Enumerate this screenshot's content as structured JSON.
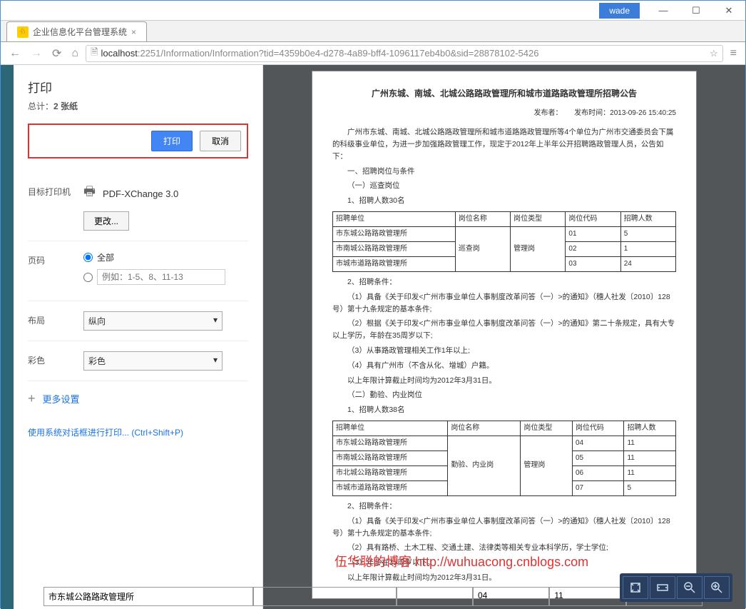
{
  "window": {
    "user": "wade",
    "tab_title": "企业信息化平台管理系统",
    "min_tip": "—",
    "max_tip": "☐",
    "close_tip": "✕"
  },
  "url": {
    "host": "localhost",
    "port": ":2251",
    "path": "/Information/Information?tid=4359b0e4-d278-4a89-bff4-1096117eb4b0&sid=28878102-5426"
  },
  "print": {
    "title": "打印",
    "total_label": "总计：",
    "total_value": "2 张纸",
    "btn_print": "打印",
    "btn_cancel": "取消",
    "dest_label": "目标打印机",
    "dest_value": "PDF-XChange 3.0",
    "change": "更改...",
    "pages_label": "页码",
    "pages_all": "全部",
    "pages_example": "例如：1-5、8、11-13",
    "layout_label": "布局",
    "layout_value": "纵向",
    "color_label": "彩色",
    "color_value": "彩色",
    "more": "更多设置",
    "system_link": "使用系统对话框进行打印... (Ctrl+Shift+P)"
  },
  "doc": {
    "title": "广州东城、南城、北城公路路政管理所和城市道路路政管理所招聘公告",
    "meta_pub": "发布者：",
    "meta_time": "发布时间：2013-09-26 15:40:25",
    "p1": "广州市东城、南城、北城公路路政管理所和城市道路路政管理所等4个单位为广州市交通委员会下属的科级事业单位，为进一步加强路政管理工作，现定于2012年上半年公开招聘路政管理人员，公告如下：",
    "h1": "一、招聘岗位与条件",
    "h1a": "（一）巡查岗位",
    "h1b": "1、招聘人数30名",
    "t1": {
      "headers": [
        "招聘单位",
        "岗位名称",
        "岗位类型",
        "岗位代码",
        "招聘人数"
      ],
      "rows": [
        [
          "市东城公路路政管理所",
          "",
          "",
          "01",
          "5"
        ],
        [
          "市南城公路路政管理所",
          "巡查岗",
          "管理岗",
          "02",
          "1"
        ],
        [
          "市城市道路路政管理所",
          "",
          "",
          "03",
          "24"
        ]
      ]
    },
    "h1c": "2、招聘条件：",
    "p2": "（1）具备《关于印发<广州市事业单位人事制度改革问答（一）>的通知》（穗人社发〔2010〕128号）第十九条规定的基本条件;",
    "p3": "（2）根据《关于印发<广州市事业单位人事制度改革问答（一）>的通知》第二十条规定，具有大专以上学历，年龄在35周岁以下;",
    "p4": "（3）从事路政管理相关工作1年以上;",
    "p5": "（4）具有广州市（不含从化、增城）户籍。",
    "p6": "以上年限计算截止时间均为2012年3月31日。",
    "h2a": "（二）勤验、内业岗位",
    "h2b": "1、招聘人数38名",
    "t2": {
      "headers": [
        "招聘单位",
        "岗位名称",
        "岗位类型",
        "岗位代码",
        "招聘人数"
      ],
      "rows": [
        [
          "市东城公路路政管理所",
          "",
          "",
          "04",
          "11"
        ],
        [
          "市南城公路路政管理所",
          "勤验、内业岗",
          "管理岗",
          "05",
          "11"
        ],
        [
          "市北城公路路政管理所",
          "",
          "",
          "06",
          "11"
        ],
        [
          "市城市道路路政管理所",
          "",
          "",
          "07",
          "5"
        ]
      ]
    },
    "h2c": "2、招聘条件：",
    "p7": "（1）具备《关于印发<广州市事业单位人事制度改革问答（一）>的通知》（穗人社发〔2010〕128号）第十九条规定的基本条件;",
    "p8": "（2）具有路桥、土木工程、交通土建、法律类等相关专业本科学历，学士学位;",
    "p9": "（3）年龄在35周岁以下。",
    "p10": "以上年限计算截止时间均为2012年3月31日。"
  },
  "watermark": "伍华聪的博客  http://wuhuacong.cnblogs.com",
  "bg": {
    "c1": "市东城公路路政管理所",
    "c2": "04",
    "c3": "11"
  }
}
